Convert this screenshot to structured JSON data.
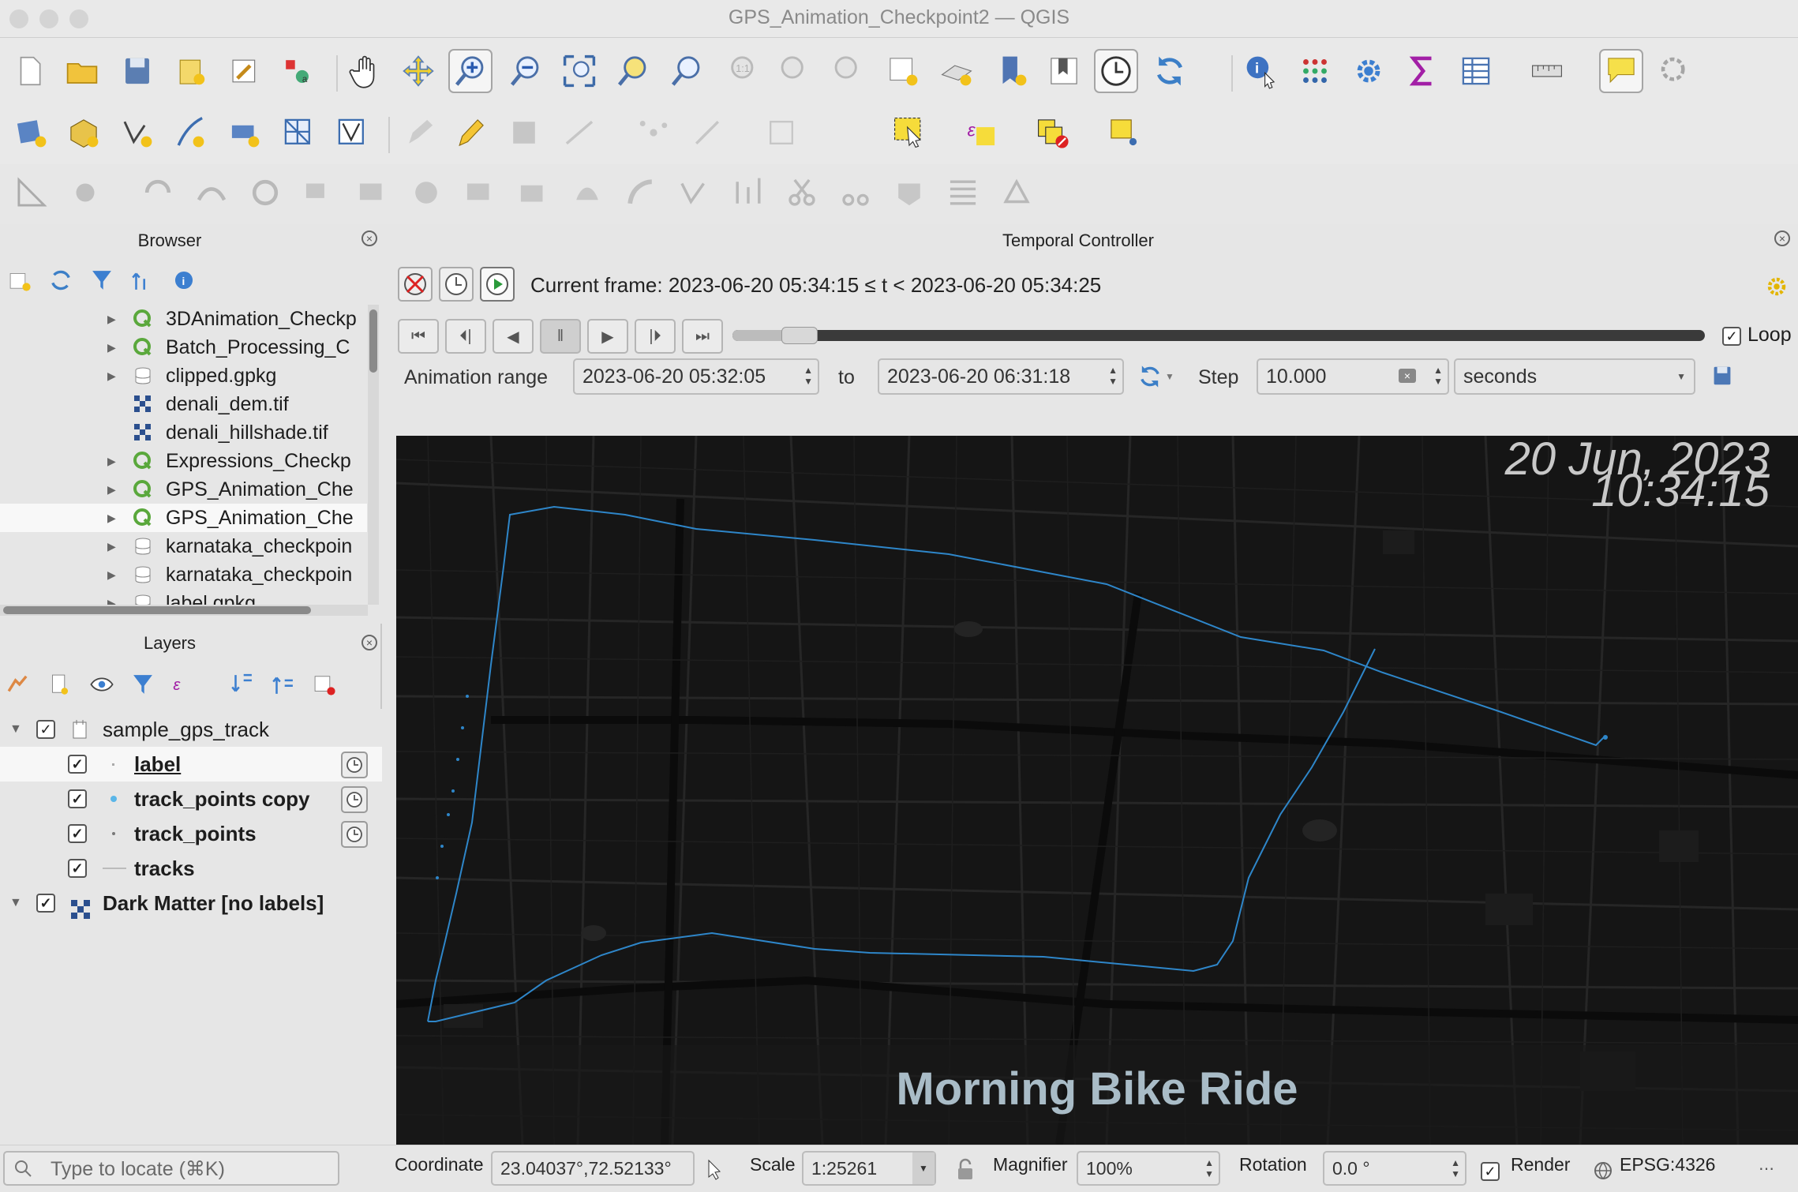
{
  "window": {
    "title": "GPS_Animation_Checkpoint2 — QGIS"
  },
  "browser": {
    "title": "Browser",
    "items": [
      {
        "label": "3DAnimation_Checkp",
        "icon": "qgis-project-icon",
        "expand": true
      },
      {
        "label": "Batch_Processing_C",
        "icon": "qgis-project-icon",
        "expand": true
      },
      {
        "label": "clipped.gpkg",
        "icon": "geopackage-icon",
        "expand": true
      },
      {
        "label": "denali_dem.tif",
        "icon": "raster-icon",
        "expand": false
      },
      {
        "label": "denali_hillshade.tif",
        "icon": "raster-icon",
        "expand": false
      },
      {
        "label": "Expressions_Checkp",
        "icon": "qgis-project-icon",
        "expand": true
      },
      {
        "label": "GPS_Animation_Che",
        "icon": "qgis-project-icon",
        "expand": true
      },
      {
        "label": "GPS_Animation_Che",
        "icon": "qgis-project-icon",
        "expand": true,
        "selected": true
      },
      {
        "label": "karnataka_checkpoin",
        "icon": "geopackage-icon",
        "expand": true
      },
      {
        "label": "karnataka_checkpoin",
        "icon": "geopackage-icon",
        "expand": true
      },
      {
        "label": "label.gpkg",
        "icon": "geopackage-icon",
        "expand": true
      }
    ]
  },
  "layers": {
    "title": "Layers",
    "group": {
      "label": "sample_gps_track"
    },
    "children": [
      {
        "label": "label",
        "temporal": true
      },
      {
        "label": "track_points copy",
        "temporal": true
      },
      {
        "label": "track_points",
        "temporal": true
      },
      {
        "label": "tracks",
        "temporal": false
      }
    ],
    "basemap": {
      "label": "Dark Matter [no labels]"
    }
  },
  "temporal": {
    "title": "Temporal Controller",
    "current_frame": "Current frame: 2023-06-20 05:34:15 ≤ t < 2023-06-20 05:34:25",
    "loop_label": "Loop",
    "range_label": "Animation range",
    "range_start": "2023-06-20 05:32:05",
    "to_label": "to",
    "range_end": "2023-06-20 06:31:18",
    "step_label": "Step",
    "step_value": "10.000",
    "step_unit": "seconds",
    "progress": 0.05
  },
  "map": {
    "date": "20 Jun, 2023",
    "time": "10:34:15",
    "caption": "Morning Bike Ride",
    "track_color": "#2e86c9",
    "background": "#151515"
  },
  "status": {
    "locate_placeholder": "Type to locate (⌘K)",
    "coordinate_label": "Coordinate",
    "coordinate_value": "23.04037°,72.52133°",
    "scale_label": "Scale",
    "scale_value": "1:25261",
    "magnifier_label": "Magnifier",
    "magnifier_value": "100%",
    "rotation_label": "Rotation",
    "rotation_value": "0.0 °",
    "render_label": "Render",
    "crs": "EPSG:4326"
  }
}
